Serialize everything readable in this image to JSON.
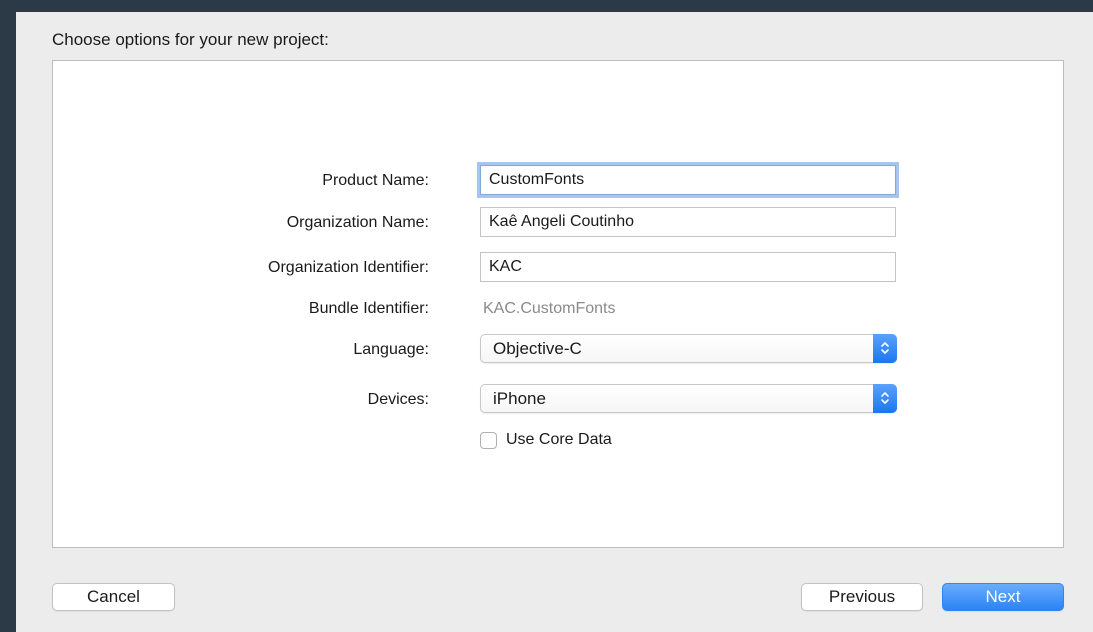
{
  "dialog": {
    "heading": "Choose options for your new project:"
  },
  "form": {
    "product_name": {
      "label": "Product Name:",
      "value": "CustomFonts"
    },
    "organization_name": {
      "label": "Organization Name:",
      "value": "Kaê Angeli Coutinho"
    },
    "organization_identifier": {
      "label": "Organization Identifier:",
      "value": "KAC"
    },
    "bundle_identifier": {
      "label": "Bundle Identifier:",
      "value": "KAC.CustomFonts"
    },
    "language": {
      "label": "Language:",
      "value": "Objective-C"
    },
    "devices": {
      "label": "Devices:",
      "value": "iPhone"
    },
    "use_core_data": {
      "label": "Use Core Data",
      "checked": false
    }
  },
  "buttons": {
    "cancel": "Cancel",
    "previous": "Previous",
    "next": "Next"
  },
  "colors": {
    "window_background": "#2c3a48",
    "sheet_background": "#ececec",
    "accent": "#2a83f6",
    "focus_ring": "#a7c6ef"
  },
  "icons": {
    "popup_arrows": "chevron-up-down-icon"
  }
}
